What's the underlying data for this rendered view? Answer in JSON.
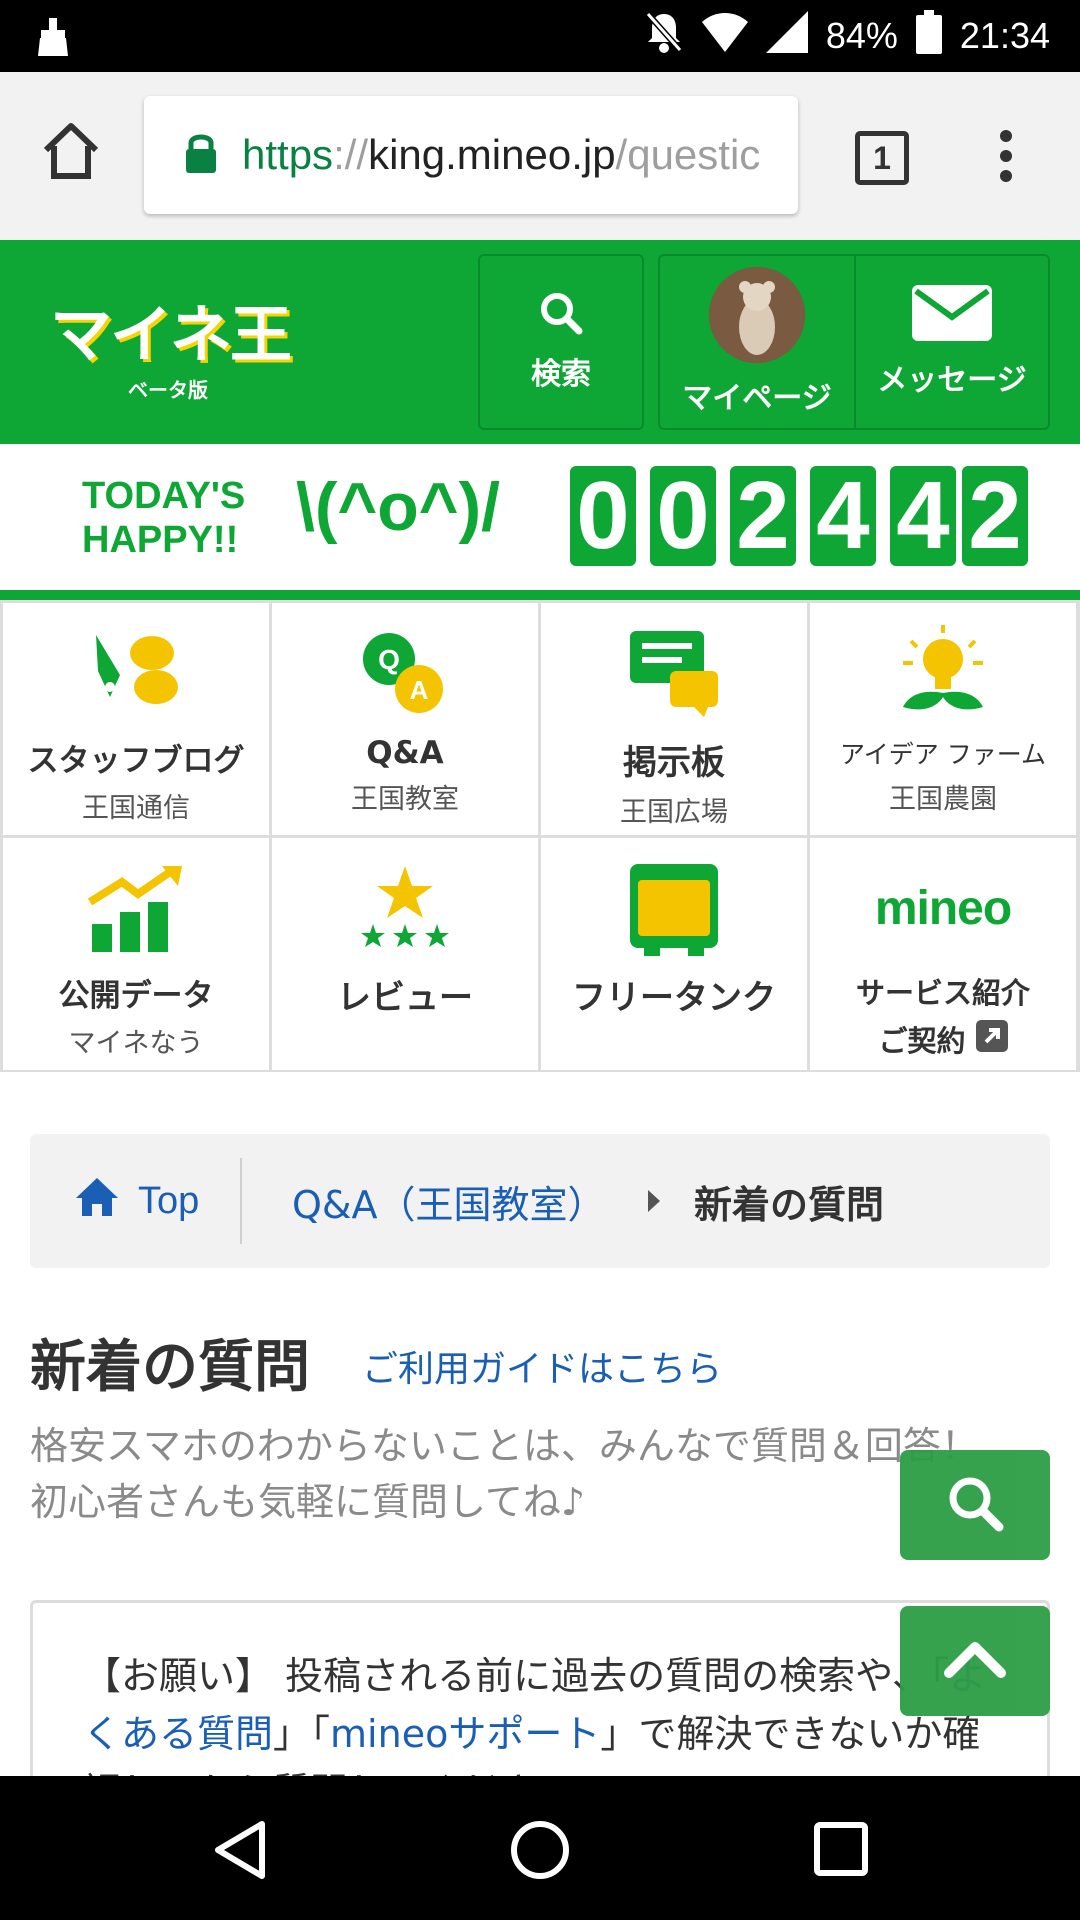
{
  "status_bar": {
    "battery": "84%",
    "time": "21:34"
  },
  "browser": {
    "url": {
      "scheme": "https",
      "separator": "://",
      "host": "king.mineo.jp",
      "path": "/questic"
    },
    "tab_count": "1"
  },
  "header": {
    "logo_text": "マイネ王",
    "logo_sub": "ベータ版",
    "search_label": "検索",
    "mypage_label": "マイページ",
    "message_label": "メッセージ",
    "brand_color": "#0ea635"
  },
  "happy_banner": {
    "line1": "TODAY'S",
    "line2": "HAPPY!!",
    "emoticon": "\\(^o^)/",
    "digits": [
      "0",
      "0",
      "2",
      "4",
      "4",
      "2"
    ]
  },
  "menu": [
    {
      "title": "スタッフブログ",
      "sub": "王国通信",
      "icon": "pen-chat-icon"
    },
    {
      "title": "Q&A",
      "sub": "王国教室",
      "icon": "qa-bubbles-icon"
    },
    {
      "title": "掲示板",
      "sub": "王国広場",
      "icon": "board-bubbles-icon"
    },
    {
      "title": "アイデア ファーム",
      "sub": "王国農園",
      "icon": "lightbulb-sprout-icon"
    },
    {
      "title": "公開データ",
      "sub": "マイネなう",
      "icon": "bar-chart-icon"
    },
    {
      "title": "レビュー",
      "sub": "",
      "icon": "stars-icon"
    },
    {
      "title": "フリータンク",
      "sub": "",
      "icon": "tank-icon"
    },
    {
      "title": "サービス紹介",
      "sub": "ご契約",
      "icon": "mineo-logo",
      "logo_text": "mineo"
    }
  ],
  "breadcrumb": {
    "home": "Top",
    "section": "Q&A（王国教室）",
    "current": "新着の質問"
  },
  "page": {
    "title": "新着の質問",
    "guide_link": "ご利用ガイドはこちら",
    "intro": "格安スマホのわからないことは、みんなで質問＆回答！　初心者さんも気軽に質問してね♪"
  },
  "notice": {
    "part1": "【お願い】 投稿される前に過去の質問の検索や、「",
    "link1": "よくある質問",
    "part2": "」「",
    "link2": "mineoサポート",
    "part3": "」で解決できないか確認してから質問してください..."
  }
}
